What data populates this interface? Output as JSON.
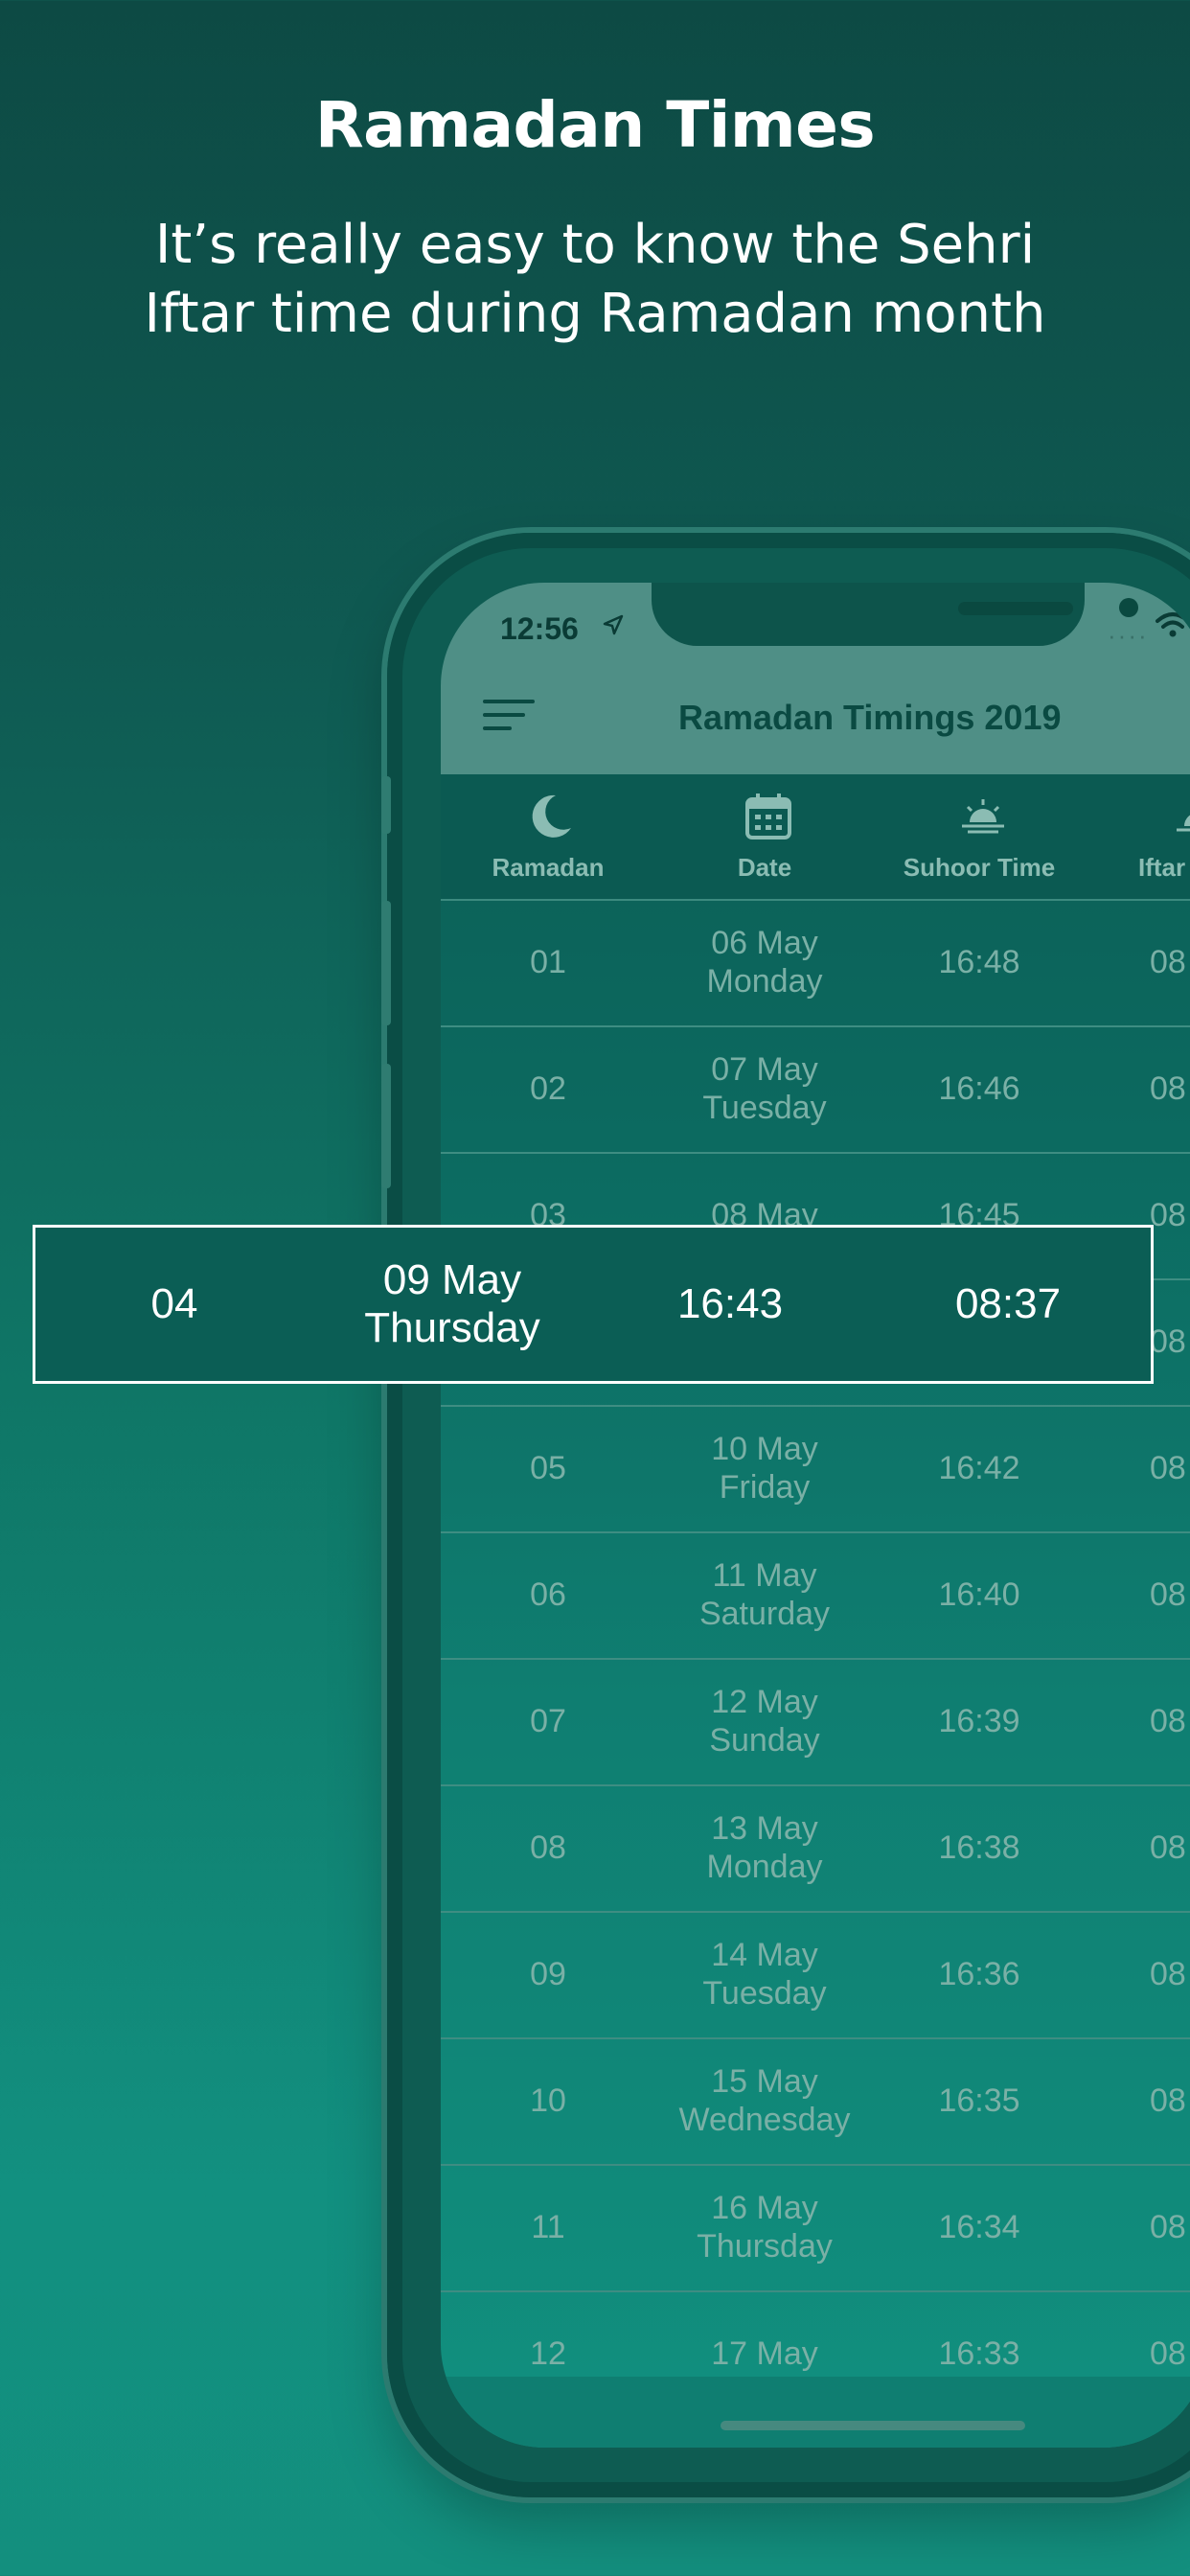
{
  "headline": "Ramadan Times",
  "subtitle": [
    "It’s really easy to know the Sehri",
    "Iftar time during Ramadan month"
  ],
  "status": {
    "time": "12:56",
    "signal": "····"
  },
  "app": {
    "title": "Ramadan Timings 2019",
    "columns": [
      {
        "label": "Ramadan",
        "icon": "moon-icon"
      },
      {
        "label": "Date",
        "icon": "calendar-icon"
      },
      {
        "label": "Suhoor Time",
        "icon": "sunrise-icon"
      },
      {
        "label": "Iftar",
        "icon": "sunset-icon"
      }
    ],
    "rows": [
      {
        "day": "01",
        "date": "06 May",
        "weekday": "Monday",
        "suhoor": "16:48",
        "iftar": "08"
      },
      {
        "day": "02",
        "date": "07 May",
        "weekday": "Tuesday",
        "suhoor": "16:46",
        "iftar": "08"
      },
      {
        "day": "03",
        "date": "08 May",
        "weekday": "",
        "suhoor": "16:45",
        "iftar": "08"
      },
      {
        "day": "",
        "date": "",
        "weekday": "",
        "suhoor": "",
        "iftar": "08"
      },
      {
        "day": "05",
        "date": "10 May",
        "weekday": "Friday",
        "suhoor": "16:42",
        "iftar": "08"
      },
      {
        "day": "06",
        "date": "11 May",
        "weekday": "Saturday",
        "suhoor": "16:40",
        "iftar": "08"
      },
      {
        "day": "07",
        "date": "12 May",
        "weekday": "Sunday",
        "suhoor": "16:39",
        "iftar": "08"
      },
      {
        "day": "08",
        "date": "13 May",
        "weekday": "Monday",
        "suhoor": "16:38",
        "iftar": "08"
      },
      {
        "day": "09",
        "date": "14 May",
        "weekday": "Tuesday",
        "suhoor": "16:36",
        "iftar": "08"
      },
      {
        "day": "10",
        "date": "15 May",
        "weekday": "Wednesday",
        "suhoor": "16:35",
        "iftar": "08"
      },
      {
        "day": "11",
        "date": "16 May",
        "weekday": "Thursday",
        "suhoor": "16:34",
        "iftar": "08"
      },
      {
        "day": "12",
        "date": "17 May",
        "weekday": "",
        "suhoor": "16:33",
        "iftar": "08"
      }
    ]
  },
  "highlight": {
    "day": "04",
    "date": "09 May",
    "weekday": "Thursday",
    "suhoor": "16:43",
    "iftar": "08:37"
  },
  "colors": {
    "accent": "#4f8f86",
    "background": "#0f7767",
    "text_dim": "#7ab0a6"
  }
}
